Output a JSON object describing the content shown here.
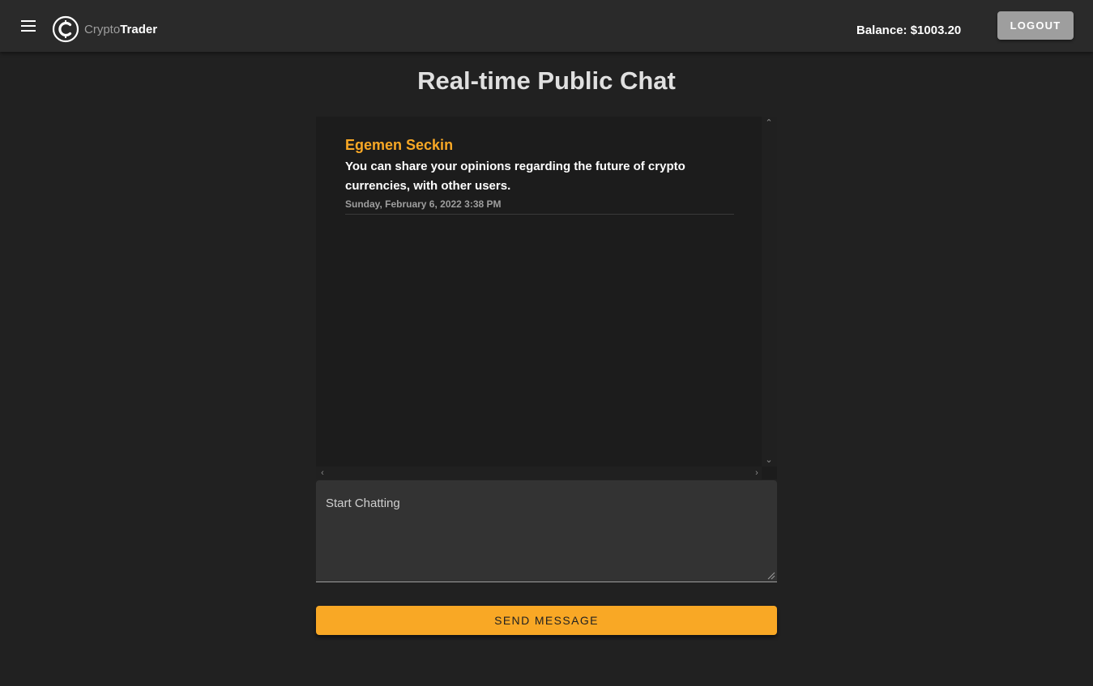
{
  "app": {
    "brand_part1": "Crypto",
    "brand_part2": "Trader",
    "logo_icon": "coin-c-icon",
    "menu_icon": "hamburger-menu-icon"
  },
  "header": {
    "balance": "Balance: $1003.20",
    "logout_label": "LOGOUT"
  },
  "page": {
    "title": "Real-time Public Chat"
  },
  "chat": {
    "messages": [
      {
        "author": "Egemen Seckin",
        "text": "You can share your opinions regarding the future of crypto currencies, with other users.",
        "timestamp": "Sunday, February 6, 2022 3:38 PM"
      }
    ],
    "input_placeholder": "Start Chatting",
    "input_value": "",
    "send_label": "SEND MESSAGE"
  },
  "colors": {
    "accent": "#f9a825",
    "background": "#212121",
    "appbar": "#2a2a2a",
    "logout_button": "#9e9e9e"
  }
}
